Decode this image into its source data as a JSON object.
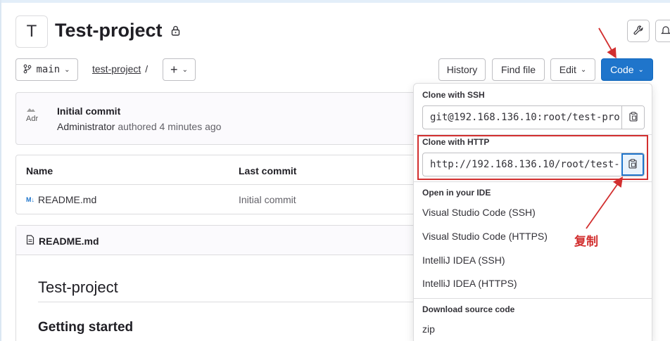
{
  "project": {
    "avatar_letter": "T",
    "title": "Test-project"
  },
  "toolbar": {
    "branch": "main",
    "breadcrumb_project": "test-project",
    "breadcrumb_sep": "/",
    "add_label": "+",
    "history": "History",
    "find_file": "Find file",
    "edit": "Edit",
    "code": "Code"
  },
  "commit": {
    "avatar_alt": "Adr",
    "title": "Initial commit",
    "author": "Administrator",
    "action": "authored 4 minutes ago"
  },
  "file_table": {
    "col_name": "Name",
    "col_last_commit": "Last commit",
    "rows": [
      {
        "icon": "M↓",
        "name": "README.md",
        "last_commit": "Initial commit"
      }
    ]
  },
  "readme": {
    "label": "README.md",
    "h1": "Test-project",
    "h2": "Getting started"
  },
  "code_dropdown": {
    "ssh_title": "Clone with SSH",
    "ssh_url": "git@192.168.136.10:root/test-pro",
    "http_title": "Clone with HTTP",
    "http_url": "http://192.168.136.10/root/test-",
    "ide_title": "Open in your IDE",
    "ide_items": [
      "Visual Studio Code (SSH)",
      "Visual Studio Code (HTTPS)",
      "IntelliJ IDEA (SSH)",
      "IntelliJ IDEA (HTTPS)"
    ],
    "download_title": "Download source code",
    "download_items": [
      "zip"
    ]
  },
  "annotation": {
    "copy_label": "复制",
    "color": "#d22f2f"
  }
}
